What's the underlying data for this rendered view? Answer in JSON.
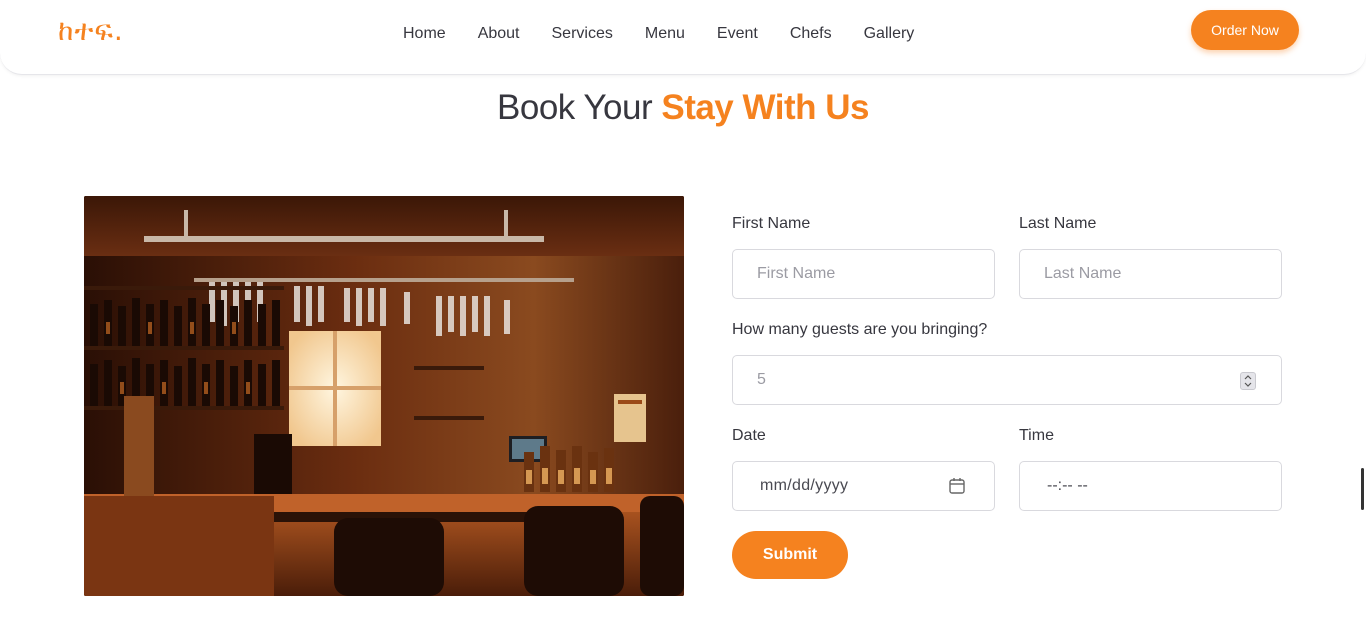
{
  "logo": {
    "text": "ከተፍ."
  },
  "nav": {
    "items": [
      "Home",
      "About",
      "Services",
      "Menu",
      "Event",
      "Chefs",
      "Gallery"
    ],
    "order_button": "Order Now"
  },
  "heading": {
    "light": "Book Your ",
    "accent": "Stay With Us"
  },
  "photo": {
    "icon": "restaurant-bar-photo"
  },
  "form": {
    "first_name_label": "First Name",
    "first_name_placeholder": "First Name",
    "last_name_label": "Last Name",
    "last_name_placeholder": "Last Name",
    "guests_label": "How many guests are you bringing?",
    "guests_placeholder": "5",
    "date_label": "Date",
    "date_placeholder": "mm/dd/yyyy",
    "time_label": "Time",
    "time_placeholder": "--:-- --",
    "submit_label": "Submit"
  },
  "colors": {
    "accent": "#f5821f",
    "text": "#37373f"
  }
}
